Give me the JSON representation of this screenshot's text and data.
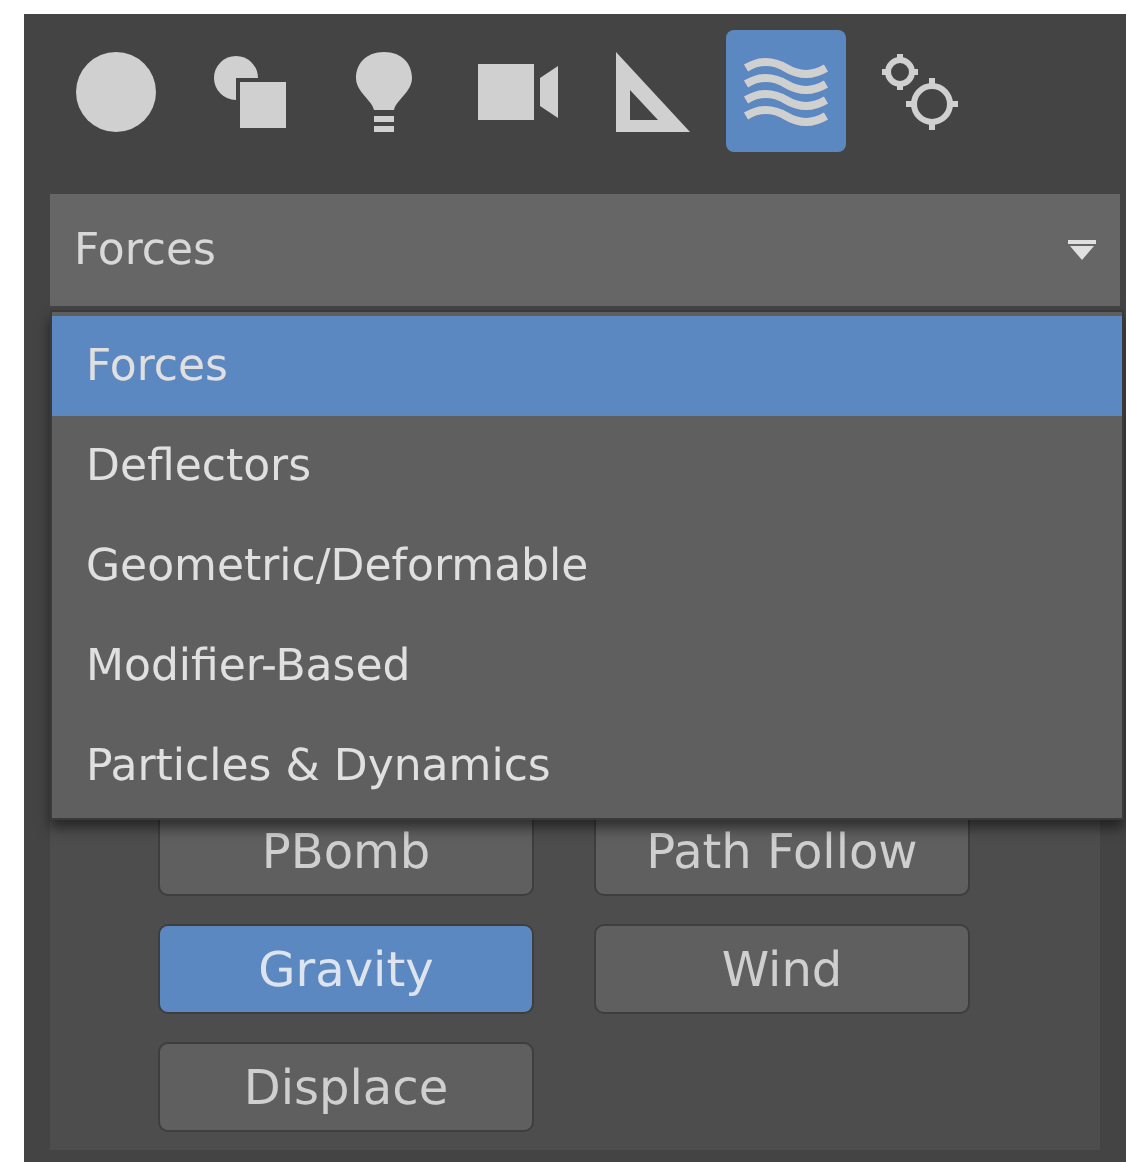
{
  "category_tabs": [
    {
      "selected": false
    },
    {
      "selected": false
    },
    {
      "selected": false
    },
    {
      "selected": false
    },
    {
      "selected": false
    },
    {
      "selected": true
    },
    {
      "selected": false
    }
  ],
  "dropdown": {
    "value": "Forces",
    "expanded": true,
    "options": [
      {
        "label": "Forces",
        "selected": true
      },
      {
        "label": "Deflectors",
        "selected": false
      },
      {
        "label": "Geometric/Deformable",
        "selected": false
      },
      {
        "label": "Modifier-Based",
        "selected": false
      },
      {
        "label": "Particles & Dynamics",
        "selected": false
      }
    ]
  },
  "object_buttons": [
    {
      "label": "PBomb",
      "selected": false
    },
    {
      "label": "Path Follow",
      "selected": false
    },
    {
      "label": "Gravity",
      "selected": true
    },
    {
      "label": "Wind",
      "selected": false
    },
    {
      "label": "Displace",
      "selected": false
    }
  ]
}
